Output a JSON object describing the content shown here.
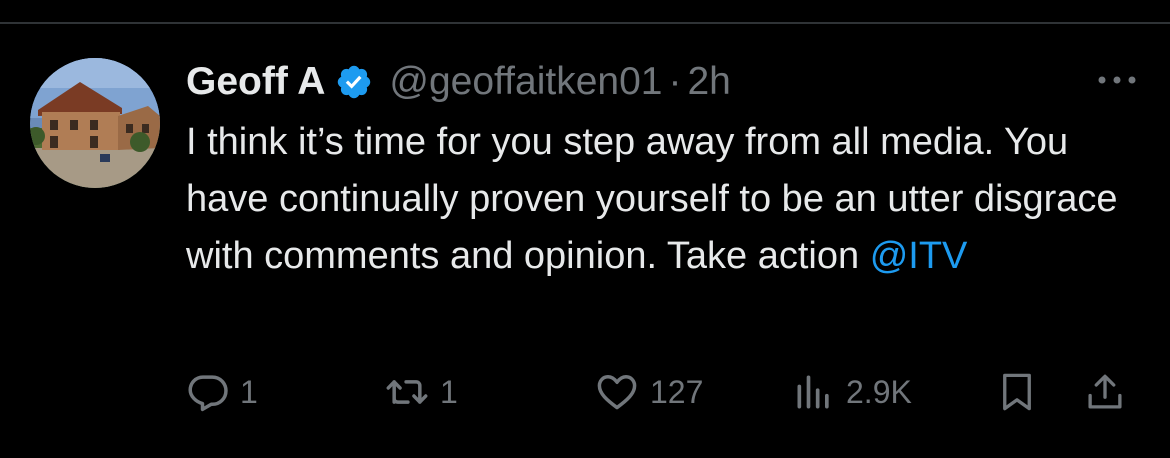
{
  "tweet": {
    "display_name": "Geoff A",
    "handle": "@geoffaitken01",
    "separator": "·",
    "time": "2h",
    "text_before_mention": "I think it’s time for you step away from all media. You have continually proven yourself to be an utter disgrace with comments and opinion. Take action ",
    "mention": "@ITV",
    "verified_color": "#1d9bf0"
  },
  "actions": {
    "reply_count": "1",
    "retweet_count": "1",
    "like_count": "127",
    "view_count": "2.9K"
  },
  "icons": {
    "reply": "reply-icon",
    "retweet": "retweet-icon",
    "like": "heart-icon",
    "views": "views-icon",
    "bookmark": "bookmark-icon",
    "share": "share-icon",
    "more": "more-icon",
    "verified": "verified-badge-icon"
  },
  "colors": {
    "background": "#000000",
    "text": "#e7e9ea",
    "secondary": "#71767b",
    "accent": "#1d9bf0"
  }
}
